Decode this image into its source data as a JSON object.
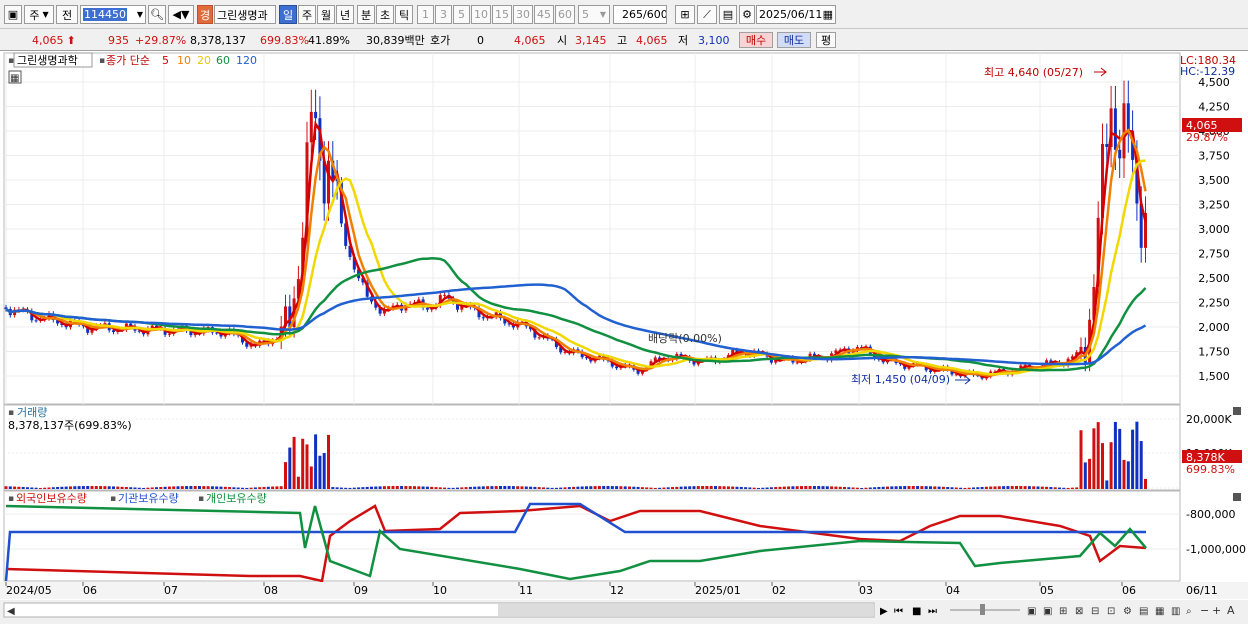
{
  "toolbar": {
    "mode_select": "주",
    "range_label": "전",
    "code": "114450",
    "badge": "경",
    "stock_name": "그린생명과",
    "periods": [
      "일",
      "주",
      "월",
      "년",
      "분",
      "초",
      "틱"
    ],
    "intervals": [
      "1",
      "3",
      "5",
      "10",
      "15",
      "30",
      "45",
      "60"
    ],
    "interval_select": "5",
    "count": "265",
    "count_total": "/600",
    "date": "2025/06/11"
  },
  "info": {
    "price": "4,065",
    "change": "935",
    "change_pct": "+29.87%",
    "volume": "8,378,137",
    "volume_pct": "699.83%",
    "turnover_pct": "41.89%",
    "amount": "30,839백만",
    "hoga_label": "호가",
    "hoga_value": "0",
    "hoga_price": "4,065",
    "open_label": "시",
    "open": "3,145",
    "high_label": "고",
    "high": "4,065",
    "low_label": "저",
    "low": "3,100",
    "buy_button": "매수",
    "sell_button": "매도",
    "eval_button": "평"
  },
  "legend": {
    "name": "그린생명과학",
    "line_label": "종가 단순",
    "ma": [
      {
        "label": "5",
        "color": "#d40000"
      },
      {
        "label": "10",
        "color": "#f08000"
      },
      {
        "label": "20",
        "color": "#f0d800"
      },
      {
        "label": "60",
        "color": "#109040"
      },
      {
        "label": "120",
        "color": "#2060d0"
      }
    ]
  },
  "price_panel": {
    "lc": "LC:180.34",
    "hc": "HC:-12.39",
    "last_price": "4,065",
    "last_pct": "29.87%",
    "high_annotation": "최고 4,640 (05/27)",
    "low_annotation": "최저 1,450 (04/09)",
    "dividend_annotation": "배당락(0.00%)",
    "y_ticks": [
      "4,500",
      "4,250",
      "4,000",
      "3,750",
      "3,500",
      "3,250",
      "3,000",
      "2,750",
      "2,500",
      "2,250",
      "2,000",
      "1,750",
      "1,500"
    ]
  },
  "volume_panel": {
    "title": "거래량",
    "value": "8,378,137주(699.83%)",
    "y_ticks": [
      "20,000K",
      "10,000K"
    ],
    "last": "8,378K",
    "last_pct": "699.83%"
  },
  "holding_panel": {
    "legend": [
      {
        "label": "외국인보유수량",
        "color": "#d01010"
      },
      {
        "label": "기관보유수량",
        "color": "#2050d0"
      },
      {
        "label": "개인보유수량",
        "color": "#109040"
      }
    ],
    "y_ticks": [
      "-800,000",
      "-1,000,000"
    ]
  },
  "x_axis": {
    "labels": [
      "2024/05",
      "06",
      "07",
      "08",
      "09",
      "10",
      "11",
      "12",
      "2025/01",
      "02",
      "03",
      "04",
      "05",
      "06"
    ],
    "right_label": "06/11"
  },
  "colors": {
    "up": "#d01010",
    "down": "#1030c0",
    "selected": "#3d6fd1"
  }
}
